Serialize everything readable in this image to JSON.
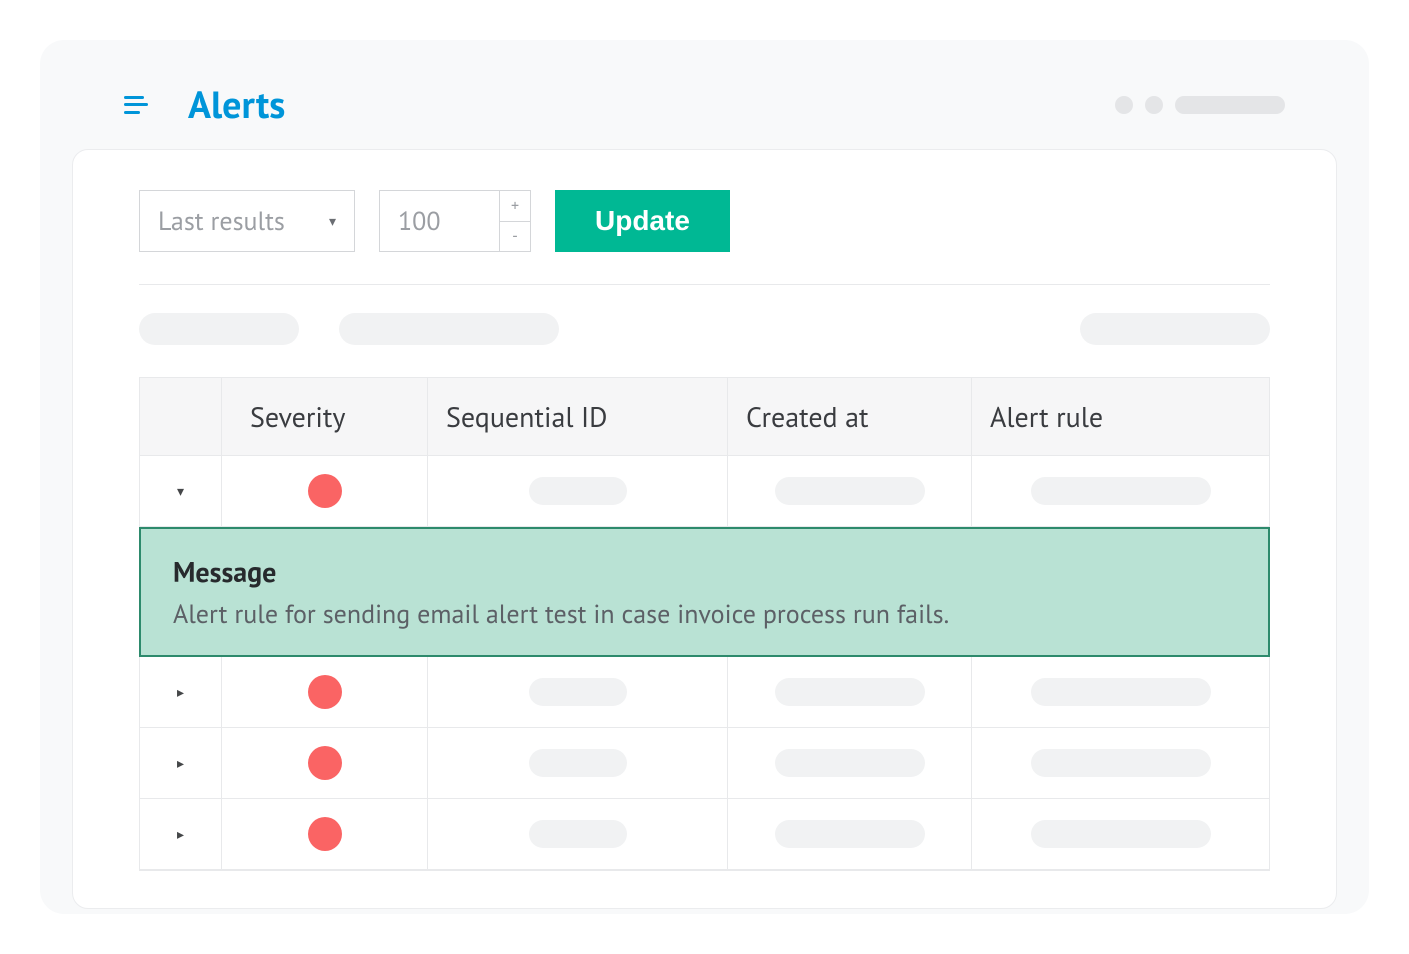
{
  "header": {
    "title": "Alerts"
  },
  "filters": {
    "dropdown_label": "Last results",
    "count_value": "100",
    "update_label": "Update"
  },
  "table": {
    "headers": {
      "severity": "Severity",
      "sequential_id": "Sequential ID",
      "created_at": "Created at",
      "alert_rule": "Alert rule"
    },
    "expanded": {
      "title": "Message",
      "text": "Alert rule for sending email alert test in case invoice process run fails."
    },
    "rows": [
      {
        "expanded": true,
        "severity_color": "#fa6464"
      },
      {
        "expanded": false,
        "severity_color": "#fa6464"
      },
      {
        "expanded": false,
        "severity_color": "#fa6464"
      },
      {
        "expanded": false,
        "severity_color": "#fa6464"
      }
    ]
  },
  "icons": {
    "spinner_plus": "+",
    "spinner_minus": "-",
    "caret_down": "▾",
    "collapsed": "▸",
    "expanded": "▾"
  }
}
